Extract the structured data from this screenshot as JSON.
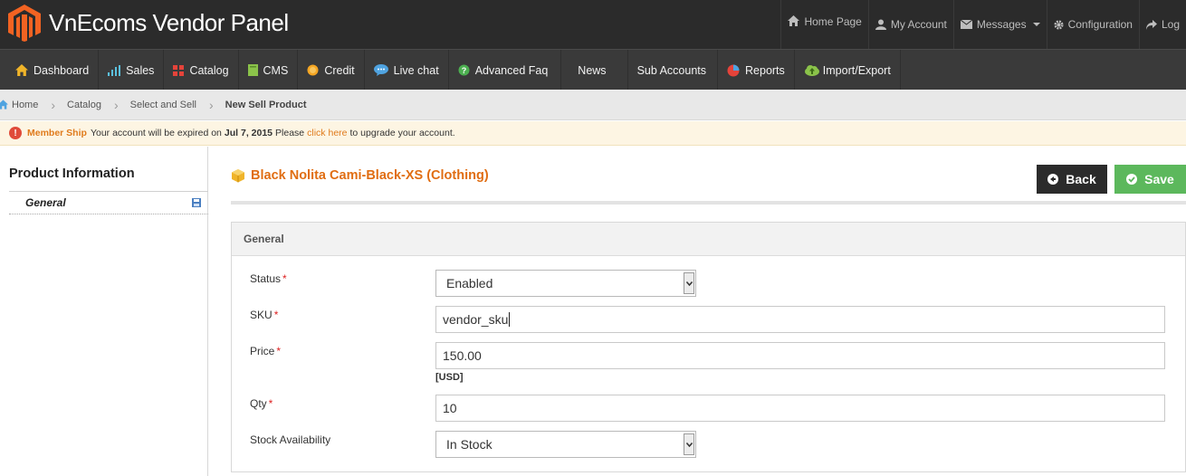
{
  "app": {
    "title": "VnEcoms Vendor Panel",
    "brand_color": "#f26322"
  },
  "header": {
    "links": [
      {
        "label": "Home Page",
        "icon": "home-icon"
      },
      {
        "label": "My Account",
        "icon": "user-icon"
      },
      {
        "label": "Messages",
        "icon": "envelope-icon"
      },
      {
        "label": "Configuration",
        "icon": "gear-icon"
      },
      {
        "label": "Log",
        "icon": "share-icon"
      }
    ]
  },
  "nav": {
    "items": [
      {
        "label": "Dashboard",
        "icon": "home-icon"
      },
      {
        "label": "Sales",
        "icon": "bar-chart-icon"
      },
      {
        "label": "Catalog",
        "icon": "grid-icon"
      },
      {
        "label": "CMS",
        "icon": "book-icon"
      },
      {
        "label": "Credit",
        "icon": "coin-icon"
      },
      {
        "label": "Live chat",
        "icon": "chat-icon"
      },
      {
        "label": "Advanced Faq",
        "icon": "question-icon"
      },
      {
        "label": "News",
        "icon": ""
      },
      {
        "label": "Sub Accounts",
        "icon": ""
      },
      {
        "label": "Reports",
        "icon": "pie-chart-icon"
      },
      {
        "label": "Import/Export",
        "icon": "cloud-icon"
      }
    ]
  },
  "breadcrumb": {
    "items": [
      "Home",
      "Catalog",
      "Select and Sell"
    ],
    "current": "New Sell Product"
  },
  "notice": {
    "title": "Member Ship",
    "text_before": "Your account will be expired on",
    "date": "Jul 7, 2015",
    "text_mid": "Please",
    "link": "click here",
    "text_after": "to upgrade your account."
  },
  "sidebar": {
    "title": "Product Information",
    "items": [
      {
        "label": "General",
        "icon": "save-icon"
      }
    ]
  },
  "product": {
    "title": "Black Nolita Cami-Black-XS (Clothing)",
    "back_label": "Back",
    "save_label": "Save"
  },
  "form": {
    "section_title": "General",
    "fields": {
      "status": {
        "label": "Status",
        "value": "Enabled"
      },
      "sku": {
        "label": "SKU",
        "value": "vendor_sku"
      },
      "price": {
        "label": "Price",
        "value": "150.00",
        "currency": "[USD]"
      },
      "qty": {
        "label": "Qty",
        "value": "10"
      },
      "stock": {
        "label": "Stock Availability",
        "value": "In Stock"
      }
    }
  }
}
